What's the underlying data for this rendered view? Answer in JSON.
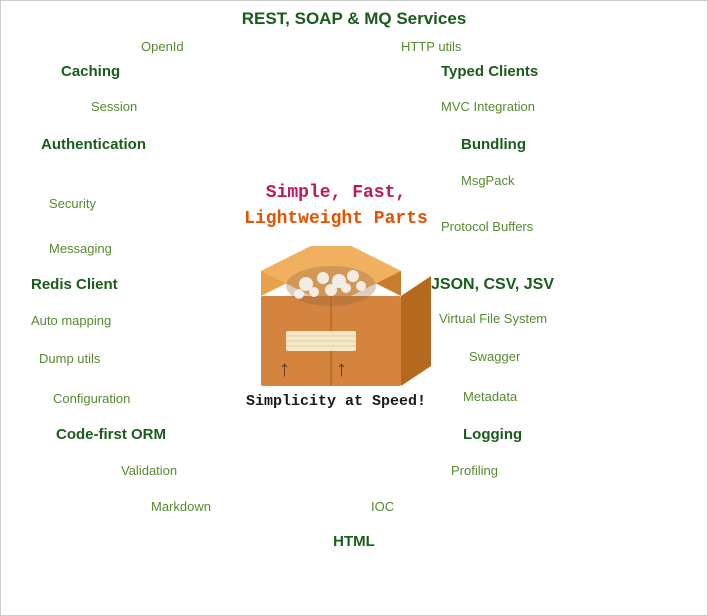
{
  "top": {
    "title": "REST, SOAP & MQ Services",
    "openid": "OpenId",
    "httputils": "HTTP utils"
  },
  "caching": {
    "label": "Caching",
    "session": "Session"
  },
  "typed_clients": {
    "label": "Typed Clients",
    "mvc": "MVC Integration"
  },
  "authentication": {
    "label": "Authentication",
    "security": "Security",
    "messaging": "Messaging"
  },
  "bundling": {
    "label": "Bundling",
    "msgpack": "MsgPack",
    "protobuf": "Protocol Buffers"
  },
  "tagline": {
    "line1": "Simple, Fast,",
    "line2": "Lightweight Parts",
    "simplicity": "Simplicity at Speed!"
  },
  "redis": {
    "label": "Redis Client",
    "automapping": "Auto mapping",
    "dumputils": "Dump utils",
    "configuration": "Configuration"
  },
  "json": {
    "label": "JSON, CSV, JSV",
    "vfs": "Virtual File System",
    "swagger": "Swagger",
    "metadata": "Metadata"
  },
  "codefirst": {
    "label": "Code-first ORM",
    "validation": "Validation",
    "markdown": "Markdown",
    "ioc": "IOC"
  },
  "logging": {
    "label": "Logging",
    "profiling": "Profiling"
  },
  "html": {
    "label": "HTML"
  }
}
